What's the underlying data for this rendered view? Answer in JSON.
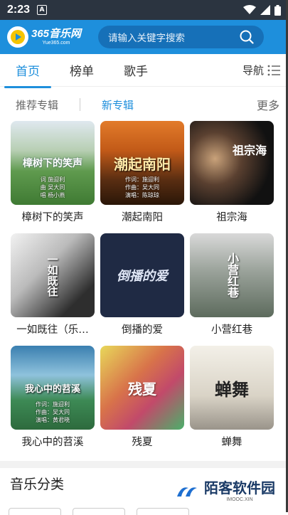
{
  "status": {
    "time": "2:23",
    "a_badge": "A"
  },
  "header": {
    "logo_main": "365音乐网",
    "logo_sub": "Yue365.com",
    "search_placeholder": "请输入关键字搜索"
  },
  "tabs": [
    {
      "label": "首页",
      "active": true
    },
    {
      "label": "榜单"
    },
    {
      "label": "歌手"
    }
  ],
  "nav_label": "导航",
  "subtabs": {
    "recommended": "推荐专辑",
    "new_albums": "新专辑",
    "more": "更多"
  },
  "albums": [
    {
      "title": "樟树下的笑声",
      "cover_text": "樟树下的笑声",
      "cover_lines": [
        "词 施迎利",
        "曲 吴大同",
        "唱 杨小燕"
      ]
    },
    {
      "title": "潮起南阳",
      "cover_text": "潮起南阳",
      "cover_lines": [
        "作词：施迎利",
        "作曲：吴大同",
        "演唱：陈琼琼"
      ]
    },
    {
      "title": "祖宗海",
      "cover_text": "祖宗海",
      "cover_lines": []
    },
    {
      "title": "一如既往（乐…",
      "cover_text": "一如既往",
      "cover_lines": []
    },
    {
      "title": "倒播的爱",
      "cover_text": "倒播的爱",
      "cover_lines": []
    },
    {
      "title": "小营红巷",
      "cover_text": "小营红巷",
      "cover_lines": []
    },
    {
      "title": "我心中的苕溪",
      "cover_text": "我心中的苕溪",
      "cover_lines": [
        "作词：施迎利",
        "作曲：吴大同",
        "演唱：黄君晓"
      ]
    },
    {
      "title": "残夏",
      "cover_text": "残夏",
      "cover_lines": []
    },
    {
      "title": "蝉舞",
      "cover_text": "蝉舞",
      "cover_lines": []
    }
  ],
  "section_title": "音乐分类",
  "watermark": {
    "main": "陌客软件园",
    "sub": "IMOOC.XIN"
  }
}
